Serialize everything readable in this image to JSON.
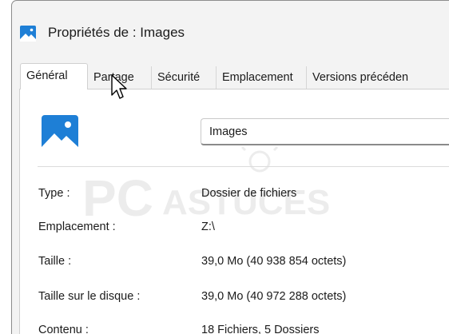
{
  "window": {
    "title": "Propriétés de : Images"
  },
  "tabs": [
    {
      "label": "Général",
      "active": true
    },
    {
      "label": "Partage",
      "active": false
    },
    {
      "label": "Sécurité",
      "active": false
    },
    {
      "label": "Emplacement",
      "active": false
    },
    {
      "label": "Versions précéden",
      "active": false
    }
  ],
  "general": {
    "name_value": "Images",
    "watermark_text": "PC ASTUCES",
    "properties": [
      {
        "label": "Type :",
        "value": "Dossier de fichiers"
      },
      {
        "label": "Emplacement :",
        "value": "Z:\\"
      },
      {
        "label": "Taille :",
        "value": "39,0 Mo (40 938 854 octets)"
      },
      {
        "label": "Taille sur le disque :",
        "value": "39,0 Mo (40 972 288 octets)"
      },
      {
        "label": "Contenu :",
        "value": "18 Fichiers, 5 Dossiers"
      }
    ]
  },
  "colors": {
    "accent_blue": "#1e7fd6",
    "window_bg": "#f3f3f3",
    "panel_bg": "#ffffff"
  },
  "icons": {
    "title": "images-folder-icon",
    "folder": "images-folder-icon",
    "pointer": "mouse-pointer-icon"
  }
}
